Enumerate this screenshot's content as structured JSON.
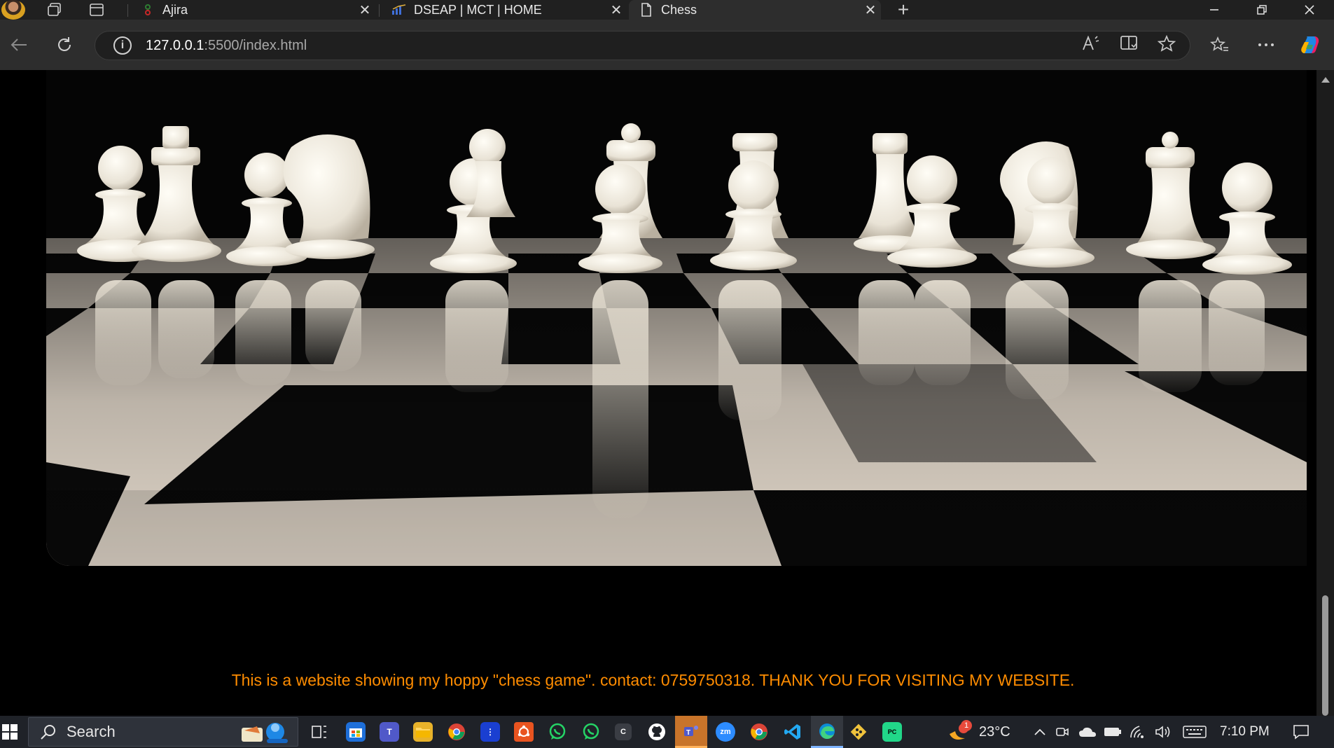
{
  "browser": {
    "tabs": [
      {
        "label": "Ajira",
        "favicon": "ajira-favicon"
      },
      {
        "label": "DSEAP | MCT | HOME",
        "favicon": "dseap-favicon"
      },
      {
        "label": "Chess",
        "favicon": "page-icon"
      }
    ],
    "new_tab_glyph": "+",
    "close_glyph": "✕",
    "url_host": "127.0.0.1",
    "url_path": ":5500/index.html"
  },
  "page": {
    "footer_text": "This is a website showing my hoppy \"chess game\". contact: 0759750318. THANK YOU FOR VISITING MY WEBSITE.",
    "footer_color": "#ff8c00",
    "background_color": "#000000"
  },
  "taskbar": {
    "search_label": "Search",
    "weather_temp": "23°C",
    "weather_badge": "1",
    "clock": "7:10 PM",
    "apps": [
      "task-view",
      "microsoft-store",
      "teams",
      "file-explorer",
      "chrome",
      "app-blue",
      "ubuntu",
      "whatsapp",
      "whatsapp-2",
      "app-c",
      "github",
      "teams-2",
      "zoom",
      "chrome-2",
      "vscode",
      "edge",
      "git",
      "pycharm"
    ]
  }
}
